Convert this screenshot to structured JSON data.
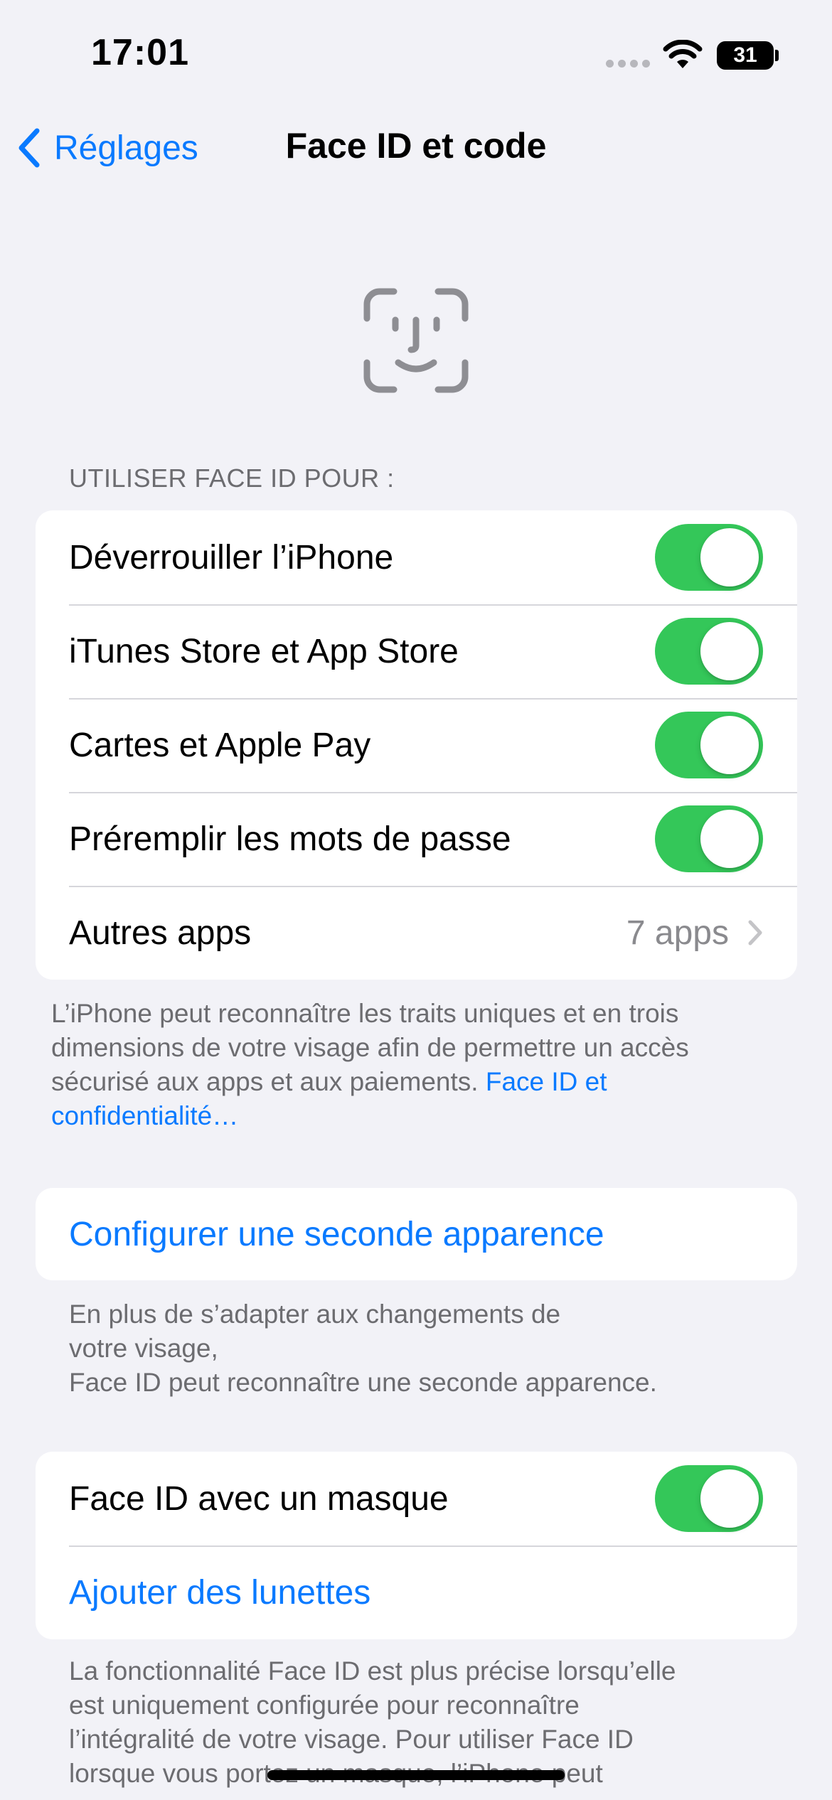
{
  "status_bar": {
    "time": "17:01",
    "battery_level": "31",
    "icons": [
      "signal-dots-icon",
      "wifi-icon",
      "battery-icon"
    ]
  },
  "nav": {
    "back_label": "Réglages",
    "title": "Face ID et code"
  },
  "header_icon": "face-id-icon",
  "use_face_id": {
    "header": "UTILISER FACE ID POUR :",
    "rows": [
      {
        "label": "Déverrouiller l’iPhone",
        "toggle_on": true
      },
      {
        "label": "iTunes Store et App Store",
        "toggle_on": true
      },
      {
        "label": "Cartes et Apple Pay",
        "toggle_on": true
      },
      {
        "label": "Préremplir les mots de passe",
        "toggle_on": true
      }
    ],
    "other_apps": {
      "label": "Autres apps",
      "value": "7 apps"
    },
    "footer_lines": [
      "L’iPhone peut reconnaître les traits uniques et en trois",
      "dimensions de votre visage afin de permettre un accès",
      "sécurisé aux apps et aux paiements."
    ],
    "footer_link_line1": "Face ID et",
    "footer_link_line2": "confidentialité…"
  },
  "alternate_appearance": {
    "button_label": "Configurer une seconde apparence",
    "footer_lines": [
      "En plus de s’adapter aux changements de",
      "votre visage,",
      "Face ID peut reconnaître une seconde apparence."
    ]
  },
  "mask": {
    "toggle_label": "Face ID avec un masque",
    "toggle_on": true,
    "glasses_label": "Ajouter des lunettes",
    "footer_lines": [
      "La fonctionnalité Face ID est plus précise lorsqu’elle",
      "est uniquement configurée pour reconnaître",
      "l’intégralité de votre visage. Pour utiliser Face ID",
      "lorsque vous portez un masque, l’iPhone peut"
    ]
  },
  "colors": {
    "accent": "#0a7aff",
    "toggle_on": "#34c759",
    "background": "#f2f2f7",
    "secondary_text": "#6c6c70"
  }
}
